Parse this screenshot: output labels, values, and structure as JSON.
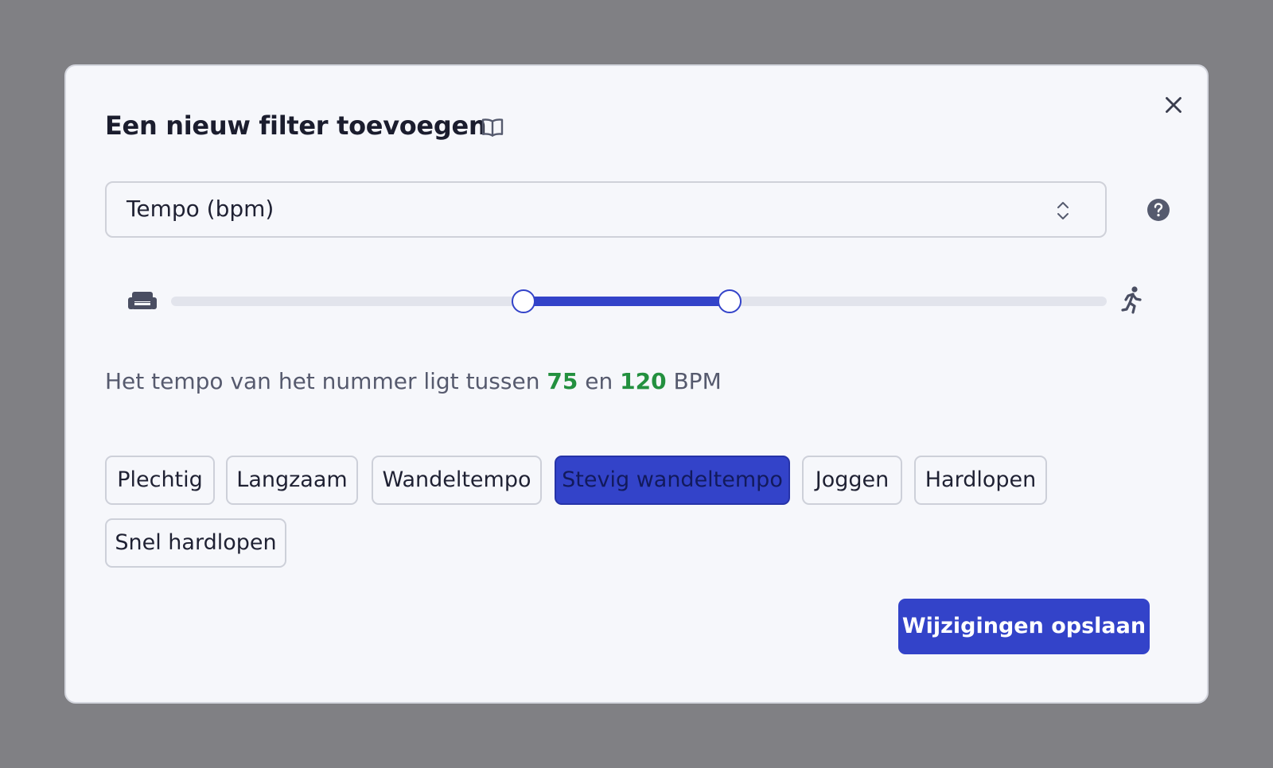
{
  "dialog": {
    "title": "Een nieuw filter toevoegen"
  },
  "filter_select": {
    "value": "Tempo (bpm)"
  },
  "slider": {
    "min_bpm": 75,
    "max_bpm": 120,
    "range_start_fraction": 0.377,
    "range_end_fraction": 0.597,
    "low_icon": "sofa-icon",
    "high_icon": "runner-icon"
  },
  "description": {
    "prefix": "Het tempo van het nummer ligt tussen",
    "min": "75",
    "connector": "en",
    "max": "120",
    "unit": "BPM"
  },
  "chips": [
    {
      "label": "Plechtig",
      "active": false
    },
    {
      "label": "Langzaam",
      "active": false
    },
    {
      "label": "Wandeltempo",
      "active": false
    },
    {
      "label": "Stevig wandeltempo",
      "active": true
    },
    {
      "label": "Joggen",
      "active": false
    },
    {
      "label": "Hardlopen",
      "active": false
    },
    {
      "label": "Snel hardlopen",
      "active": false
    }
  ],
  "actions": {
    "save_label": "Wijzigingen opslaan"
  },
  "colors": {
    "accent": "#3343c9",
    "value_green": "#23903f",
    "overlay": "#808084",
    "dialog_bg": "#f6f7fb"
  }
}
